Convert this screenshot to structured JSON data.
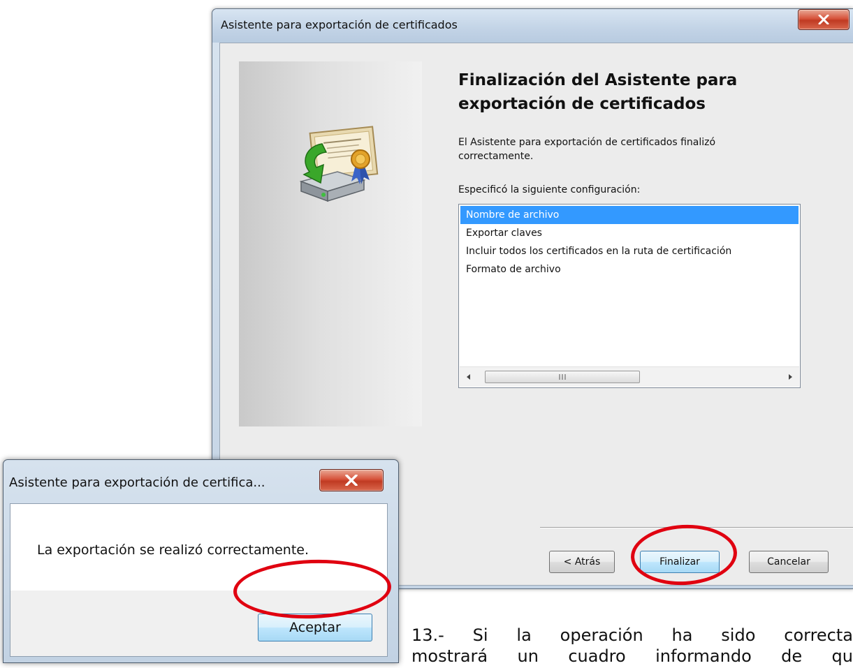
{
  "wizard": {
    "title": "Asistente para exportación de certificados",
    "heading": "Finalización del Asistente para exportación de certificados",
    "description": "El Asistente para exportación de certificados finalizó correctamente.",
    "config_label": "Especificó la siguiente configuración:",
    "settings_list": [
      {
        "label": "Nombre de archivo",
        "selected": true
      },
      {
        "label": "Exportar claves",
        "selected": false
      },
      {
        "label": "Incluir todos los certificados en la ruta de certificación",
        "selected": false
      },
      {
        "label": "Formato de archivo",
        "selected": false
      }
    ],
    "buttons": {
      "back": "< Atrás",
      "finish": "Finalizar",
      "cancel": "Cancelar"
    }
  },
  "message_box": {
    "title": "Asistente para exportación de certifica...",
    "message": "La exportación se realizó correctamente.",
    "ok_button": "Aceptar"
  },
  "instruction": {
    "line1": "13.- Si la operación ha sido correcta",
    "line2": "mostrará un cuadro informando de qu"
  },
  "colors": {
    "selection": "#3399ff",
    "annotation": "#e00010",
    "close_button": "#c8432b"
  }
}
